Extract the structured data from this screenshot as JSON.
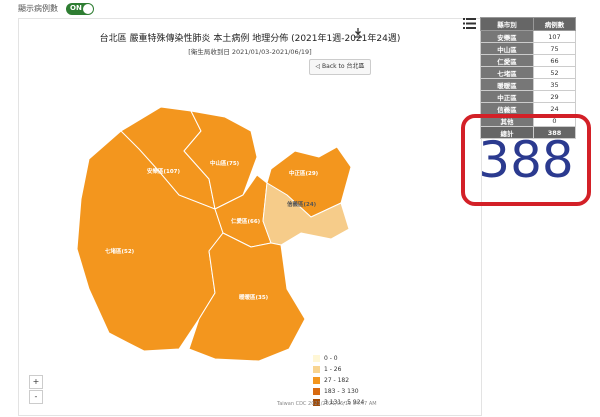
{
  "toggle": {
    "label": "顯示病例數",
    "state": "ON"
  },
  "map": {
    "title": "台北區 嚴重特殊傳染性肺炎 本土病例 地理分佈 (2021年1週-2021年24週)",
    "subtitle": "[衛生局收到日 2021/01/03-2021/06/19]",
    "back_button": "◁ Back to 台北區",
    "districts": [
      {
        "label": "安樂區(107)",
        "fill": "#f3961e"
      },
      {
        "label": "中山區(75)",
        "fill": "#f3961e"
      },
      {
        "label": "中正區(29)",
        "fill": "#f3961e"
      },
      {
        "label": "信義區(24)",
        "fill": "#f6cc8a"
      },
      {
        "label": "仁愛區(66)",
        "fill": "#f3961e"
      },
      {
        "label": "七堵區(52)",
        "fill": "#f3961e"
      },
      {
        "label": "暖暖區(35)",
        "fill": "#f3961e"
      }
    ],
    "legend": [
      {
        "label": "0 - 0",
        "color": "#fff7d6"
      },
      {
        "label": "1 - 26",
        "color": "#f8d490"
      },
      {
        "label": "27 - 182",
        "color": "#f3961e"
      },
      {
        "label": "183 - 3 130",
        "color": "#d86a10"
      },
      {
        "label": "3 131 - 5 924",
        "color": "#a04a08"
      }
    ],
    "credits": "Taiwan CDC 2021/2021/06/19 04:47 AM",
    "zoom_in": "+",
    "zoom_out": "-"
  },
  "table": {
    "headers": [
      "縣市別",
      "病例數"
    ],
    "rows": [
      {
        "name": "安樂區",
        "count": "107"
      },
      {
        "name": "中山區",
        "count": "75"
      },
      {
        "name": "仁愛區",
        "count": "66"
      },
      {
        "name": "七堵區",
        "count": "52"
      },
      {
        "name": "暖暖區",
        "count": "35"
      },
      {
        "name": "中正區",
        "count": "29"
      },
      {
        "name": "信義區",
        "count": "24"
      },
      {
        "name": "其他",
        "count": "0"
      }
    ],
    "total": {
      "name": "總計",
      "count": "388"
    }
  },
  "highlight": {
    "value": "388",
    "border_color": "#d32027",
    "text_color": "#2b3a8f"
  }
}
